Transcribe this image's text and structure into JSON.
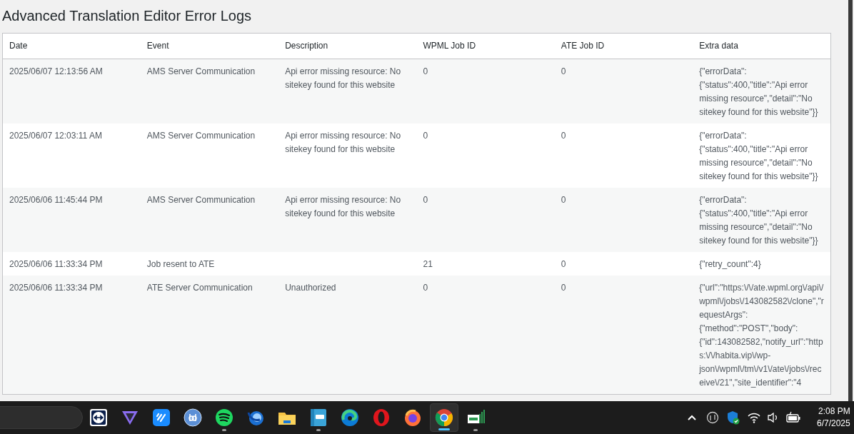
{
  "page": {
    "title": "Advanced Translation Editor Error Logs"
  },
  "table": {
    "columns": [
      "Date",
      "Event",
      "Description",
      "WPML Job ID",
      "ATE Job ID",
      "Extra data"
    ],
    "rows": [
      {
        "cells": [
          "2025/06/07 12:13:56 AM",
          "AMS Server Communication",
          "Api error missing resource: No sitekey found for this website",
          "0",
          "0",
          "{\"errorData\":{\"status\":400,\"title\":\"Api error missing resource\",\"detail\":\"No sitekey found for this website\"}}"
        ]
      },
      {
        "cells": [
          "2025/06/07 12:03:11 AM",
          "AMS Server Communication",
          "Api error missing resource: No sitekey found for this website",
          "0",
          "0",
          "{\"errorData\":{\"status\":400,\"title\":\"Api error missing resource\",\"detail\":\"No sitekey found for this website\"}}"
        ]
      },
      {
        "cells": [
          "2025/06/06 11:45:44 PM",
          "AMS Server Communication",
          "Api error missing resource: No sitekey found for this website",
          "0",
          "0",
          "{\"errorData\":{\"status\":400,\"title\":\"Api error missing resource\",\"detail\":\"No sitekey found for this website\"}}"
        ]
      },
      {
        "cells": [
          "2025/06/06 11:33:34 PM",
          "Job resent to ATE",
          "",
          "21",
          "0",
          "{\"retry_count\":4}"
        ]
      },
      {
        "cells": [
          "2025/06/06 11:33:34 PM",
          "ATE Server Communication",
          "Unauthorized",
          "0",
          "0",
          "{\"url\":\"https:\\/\\/ate.wpml.org\\/api\\/wpml\\/jobs\\/143082582\\/clone\",\"requestArgs\":{\"method\":\"POST\",\"body\":{\"id\":143082582,\"notify_url\":\"https:\\/\\/habita.vip\\/wp-json\\/wpml\\/tm\\/v1\\/ate\\/jobs\\/receive\\/21\",\"site_identifier\":\"4"
        ]
      }
    ]
  },
  "taskbar": {
    "apps": [
      {
        "kind": "remote",
        "running": false,
        "active": false
      },
      {
        "kind": "vpn",
        "running": false,
        "active": false
      },
      {
        "kind": "chat",
        "running": false,
        "active": false
      },
      {
        "kind": "torrent",
        "running": false,
        "active": false
      },
      {
        "kind": "music",
        "running": true,
        "active": false
      },
      {
        "kind": "mail",
        "running": false,
        "active": false
      },
      {
        "kind": "folder",
        "running": false,
        "active": false
      },
      {
        "kind": "notes",
        "running": true,
        "active": false
      },
      {
        "kind": "edge",
        "running": false,
        "active": false
      },
      {
        "kind": "opera",
        "running": false,
        "active": false
      },
      {
        "kind": "firefox",
        "running": false,
        "active": false
      },
      {
        "kind": "chrome",
        "running": true,
        "active": true
      },
      {
        "kind": "desk",
        "running": true,
        "active": false
      }
    ],
    "time": "2:08 PM",
    "date": "6/7/2025"
  }
}
